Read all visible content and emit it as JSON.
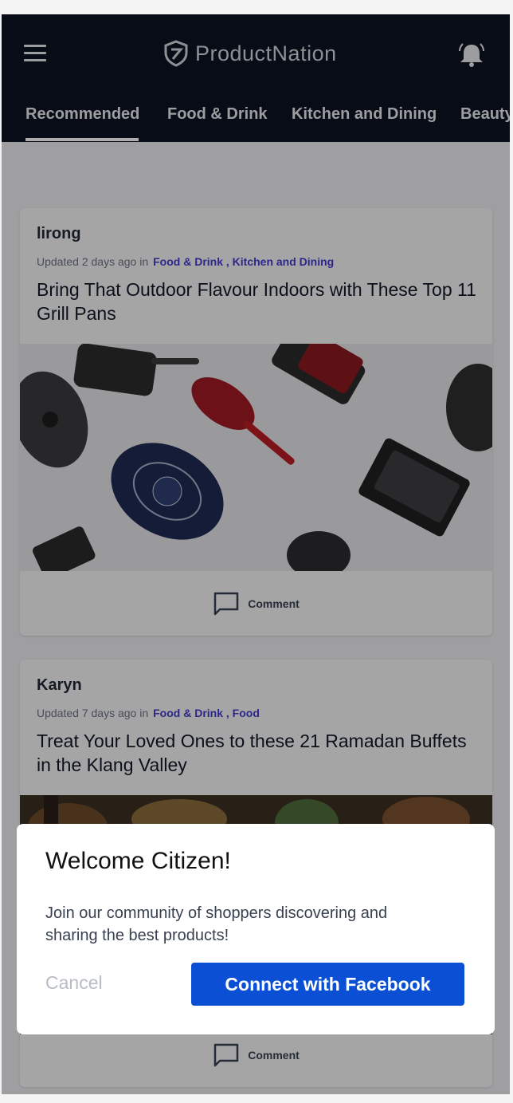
{
  "app": {
    "brand": "ProductNation",
    "colors": {
      "header_bg": "#0b1222",
      "category_link": "#4338ca",
      "primary_button": "#0b4fd4"
    }
  },
  "header": {
    "menu_icon": "hamburger-menu-icon",
    "logo_icon": "productnation-shield-logo",
    "bell_icon": "notification-bell-icon"
  },
  "tabs": [
    {
      "label": "Recommended",
      "active": true
    },
    {
      "label": "Food & Drink"
    },
    {
      "label": "Kitchen and Dining"
    },
    {
      "label": "Beauty"
    }
  ],
  "articles": [
    {
      "author": "lirong",
      "updated": "Updated 2 days ago in",
      "categories": "Food & Drink , Kitchen and Dining",
      "title": "Bring That Outdoor Flavour Indoors with These Top 11 Grill Pans",
      "comment_label": "Comment"
    },
    {
      "author": "Karyn",
      "updated": "Updated 7 days ago in",
      "categories": "Food & Drink , Food",
      "title": "Treat Your Loved Ones to these 21 Ramadan Buffets in the Klang Valley",
      "comment_label": "Comment"
    }
  ],
  "dialog": {
    "title": "Welcome Citizen!",
    "body": "Join our community of shoppers discovering and sharing the best products!",
    "cancel_label": "Cancel",
    "connect_label": "Connect with Facebook"
  }
}
